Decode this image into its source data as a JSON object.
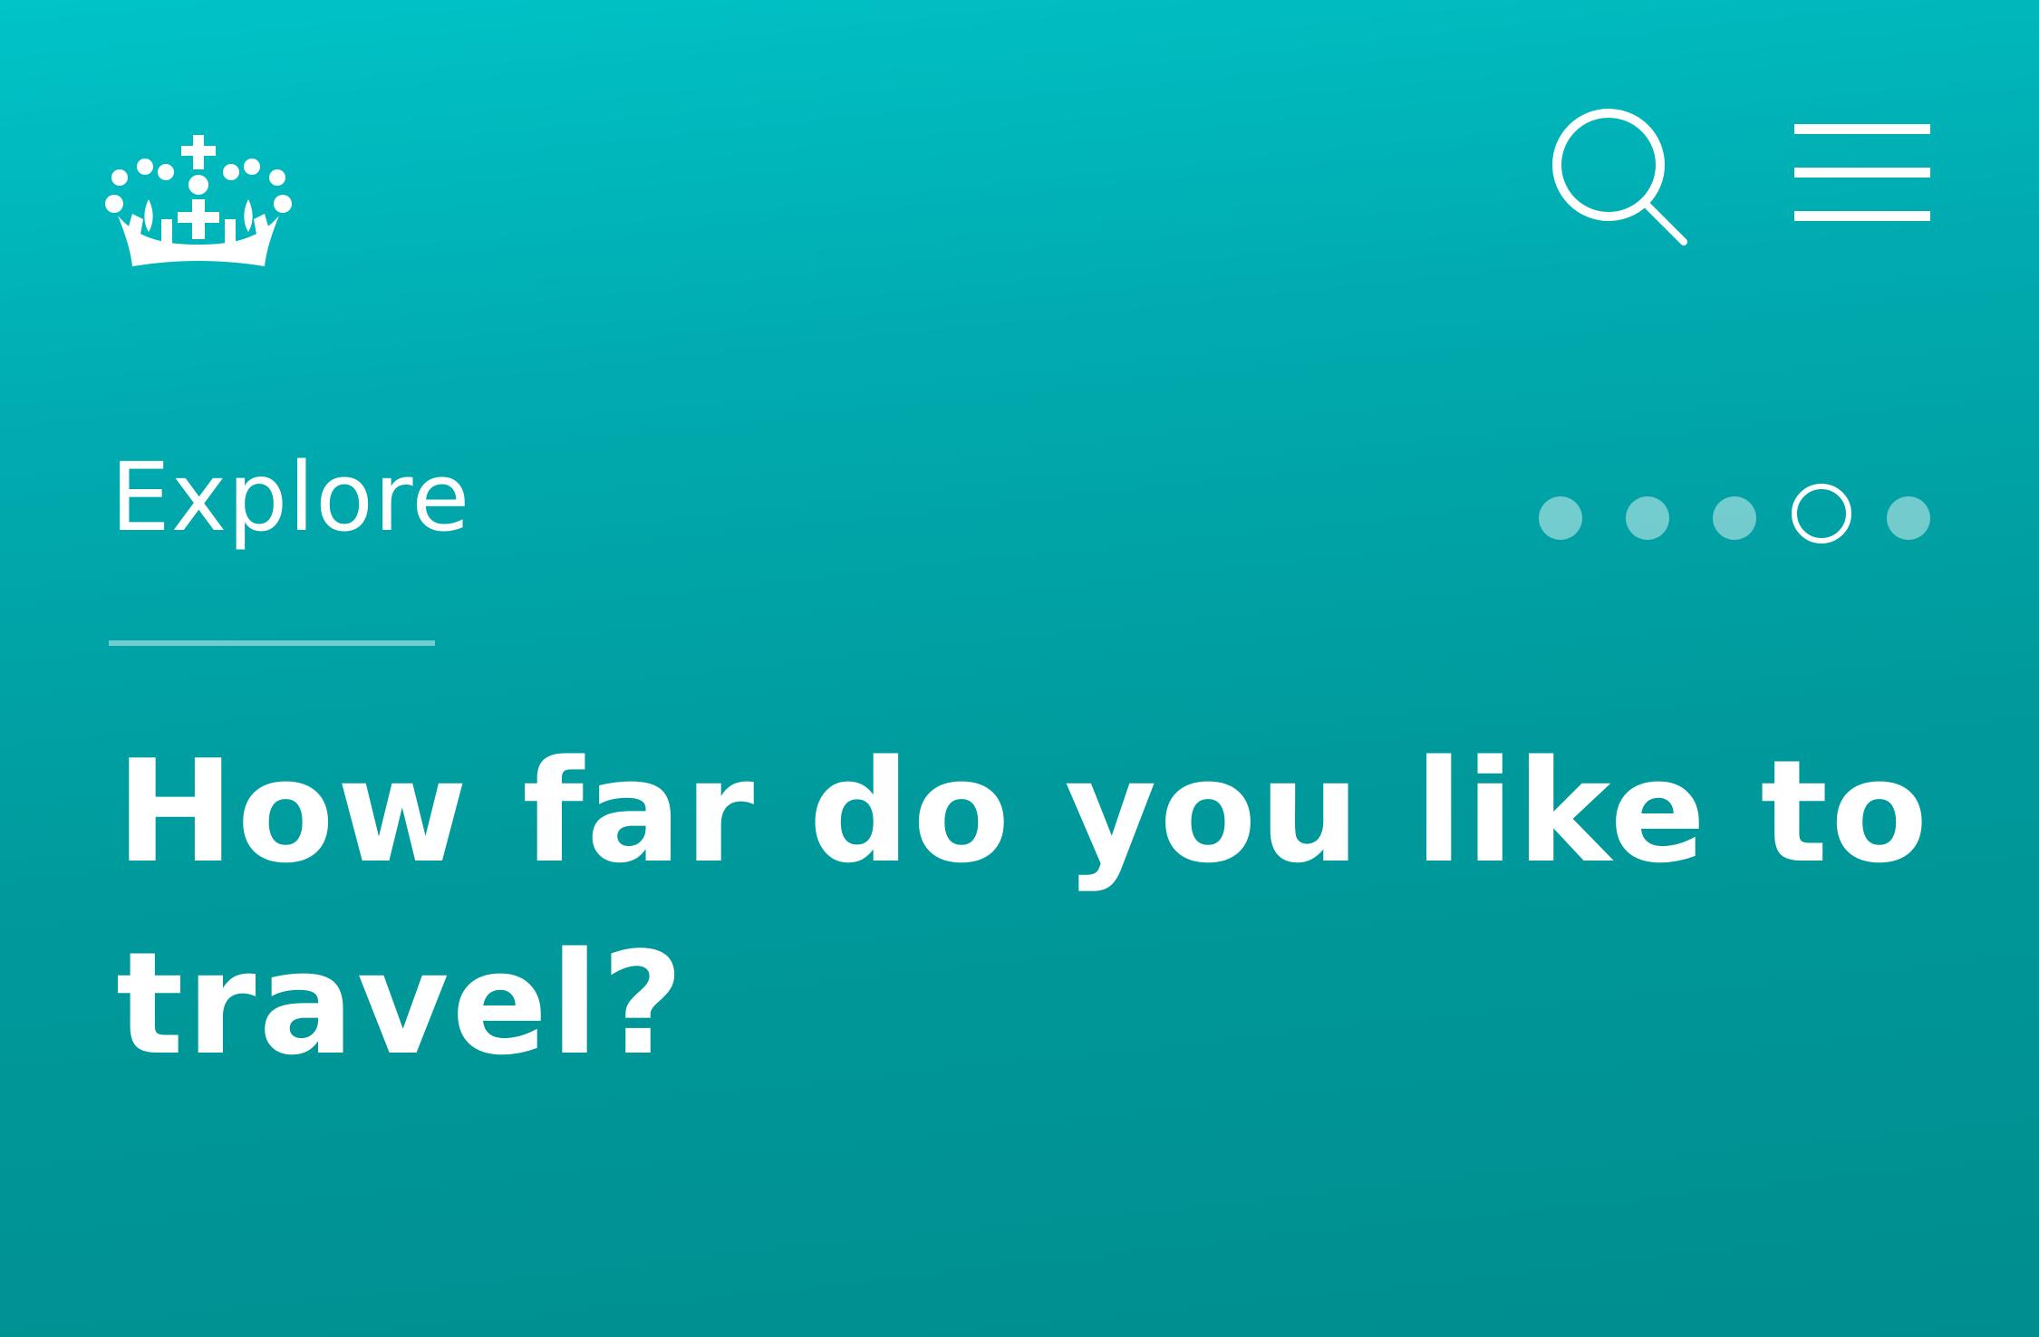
{
  "header": {
    "logo_icon": "crown-icon",
    "search_icon": "search-icon",
    "menu_icon": "hamburger-menu-icon"
  },
  "section": {
    "label": "Explore"
  },
  "pager": {
    "total": 5,
    "active_index": 3
  },
  "question": {
    "text": "How far do you like to travel?"
  },
  "colors": {
    "gradient_top": "#00c4c8",
    "gradient_bottom": "#008d8f",
    "foreground": "#ffffff"
  }
}
